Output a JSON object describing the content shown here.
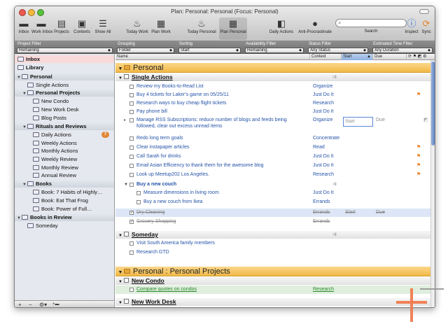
{
  "window": {
    "title": "Plan: Personal: Personal (Focus: Personal)"
  },
  "toolbar": {
    "items": [
      {
        "label": "Inbox",
        "icon": "inbox-icon"
      },
      {
        "label": "Work Inbox",
        "icon": "inbox-icon"
      },
      {
        "label": "Projects",
        "icon": "projects-icon"
      },
      {
        "label": "Contexts",
        "icon": "contexts-icon"
      },
      {
        "label": "Show All",
        "icon": "show-all-icon"
      },
      {
        "label": "Today Work",
        "icon": "flame-icon"
      },
      {
        "label": "Plan Work",
        "icon": "calendar-icon"
      },
      {
        "label": "Today Personal",
        "icon": "flame-icon"
      },
      {
        "label": "Plan Personal",
        "icon": "calendar-icon"
      },
      {
        "label": "Daily Actions",
        "icon": "daily-icon"
      },
      {
        "label": "Anti-Procrastinate",
        "icon": "globe-icon"
      },
      {
        "label": "Search",
        "icon": "search-icon"
      },
      {
        "label": "Inspect",
        "icon": "info-icon"
      },
      {
        "label": "Sync",
        "icon": "sync-icon"
      }
    ],
    "search_placeholder": ""
  },
  "filters": [
    {
      "label": "Project Filter",
      "value": "Remaining"
    },
    {
      "label": "Grouping",
      "value": "Folder"
    },
    {
      "label": "Sorting",
      "value": "Start"
    },
    {
      "label": "Availability Filter",
      "value": "Remaining"
    },
    {
      "label": "Status Filter",
      "value": "Any Status"
    },
    {
      "label": "Estimated Time Filter",
      "value": "Any Duration"
    }
  ],
  "sidebar": {
    "items": [
      {
        "label": "Inbox",
        "type": "top"
      },
      {
        "label": "Library",
        "type": "top"
      },
      {
        "label": "Personal",
        "type": "folder"
      },
      {
        "label": "Single Actions",
        "type": "item"
      },
      {
        "label": "Personal Projects",
        "type": "folder"
      },
      {
        "label": "New Condo",
        "type": "sub"
      },
      {
        "label": "New Work Desk",
        "type": "sub"
      },
      {
        "label": "Blog Posts",
        "type": "sub"
      },
      {
        "label": "Rituals and Reviews",
        "type": "folder"
      },
      {
        "label": "Daily Actions",
        "type": "sub",
        "badge": "7"
      },
      {
        "label": "Weekly Actions",
        "type": "sub"
      },
      {
        "label": "Monthly Actions",
        "type": "sub"
      },
      {
        "label": "Weekly Review",
        "type": "sub"
      },
      {
        "label": "Monthly Review",
        "type": "sub"
      },
      {
        "label": "Annual Review",
        "type": "sub"
      },
      {
        "label": "Books",
        "type": "folder"
      },
      {
        "label": "Book: 7 Habits of Highly…",
        "type": "sub"
      },
      {
        "label": "Book: Eat That Frog",
        "type": "sub"
      },
      {
        "label": "Book: Power of Full…",
        "type": "sub"
      },
      {
        "label": "Books in Review",
        "type": "folder"
      },
      {
        "label": "Someday",
        "type": "item"
      }
    ]
  },
  "columns": {
    "name": "Name",
    "context": "Context",
    "start": "Start",
    "due": "Due"
  },
  "outline": {
    "group1": "Personal",
    "single_actions": "Single Actions",
    "tasks": [
      {
        "name": "Review my Books-to-Read List",
        "context": "Organize",
        "flag": false
      },
      {
        "name": "Buy 4 tickets for Laker's game on 05/25/11",
        "context": "Just Do It",
        "flag": true
      },
      {
        "name": "Research ways to buy cheap flight tickets",
        "context": "Research",
        "flag": false
      },
      {
        "name": "Pay phone bill",
        "context": "Just Do It",
        "flag": false
      }
    ],
    "rss_task": {
      "line1": "Manage RSS Subscriptions: reduce number of blogs and feeds being",
      "line2": "followed, clear out excess unread items",
      "context": "Organize",
      "start_placeholder": "Start",
      "due": "Due"
    },
    "tasks2": [
      {
        "name": "Redo long term goals",
        "context": "Concentrate",
        "flag": false
      },
      {
        "name": "Clear instapaper articles",
        "context": "Read",
        "flag": true
      },
      {
        "name": "Call Sarah for drinks",
        "context": "Just Do It",
        "flag": true
      },
      {
        "name": "Email Asian Efficiency to thank them for the awesome blog",
        "context": "Just Do It",
        "flag": true
      },
      {
        "name": "Look up Meetup202 Los Angeles.",
        "context": "Research",
        "flag": true
      }
    ],
    "couch": {
      "name": "Buy a new couch",
      "context": ""
    },
    "couch_subs": [
      {
        "name": "Measure dimensions in living room",
        "context": "Just Do It"
      },
      {
        "name": "Buy a new couch from Ikea",
        "context": "Errands"
      }
    ],
    "done": [
      {
        "name": "Dry Cleaning",
        "context": "Errands",
        "start": "Start",
        "due": "Due"
      },
      {
        "name": "Grocery Shopping",
        "context": "Errands"
      }
    ],
    "someday": "Someday",
    "someday_tasks": [
      {
        "name": "Visit South America family members",
        "context": ""
      },
      {
        "name": "Research GTD",
        "context": ""
      }
    ],
    "group2": "Personal : Personal Projects",
    "new_condo": "New Condo",
    "condo_task": {
      "name": "Compare quotes on condos",
      "context": "Research"
    },
    "new_work_desk": "New Work Desk"
  },
  "colors": {
    "accent": "#f1b949",
    "link": "#2553a8",
    "flag": "#e77b1e"
  }
}
